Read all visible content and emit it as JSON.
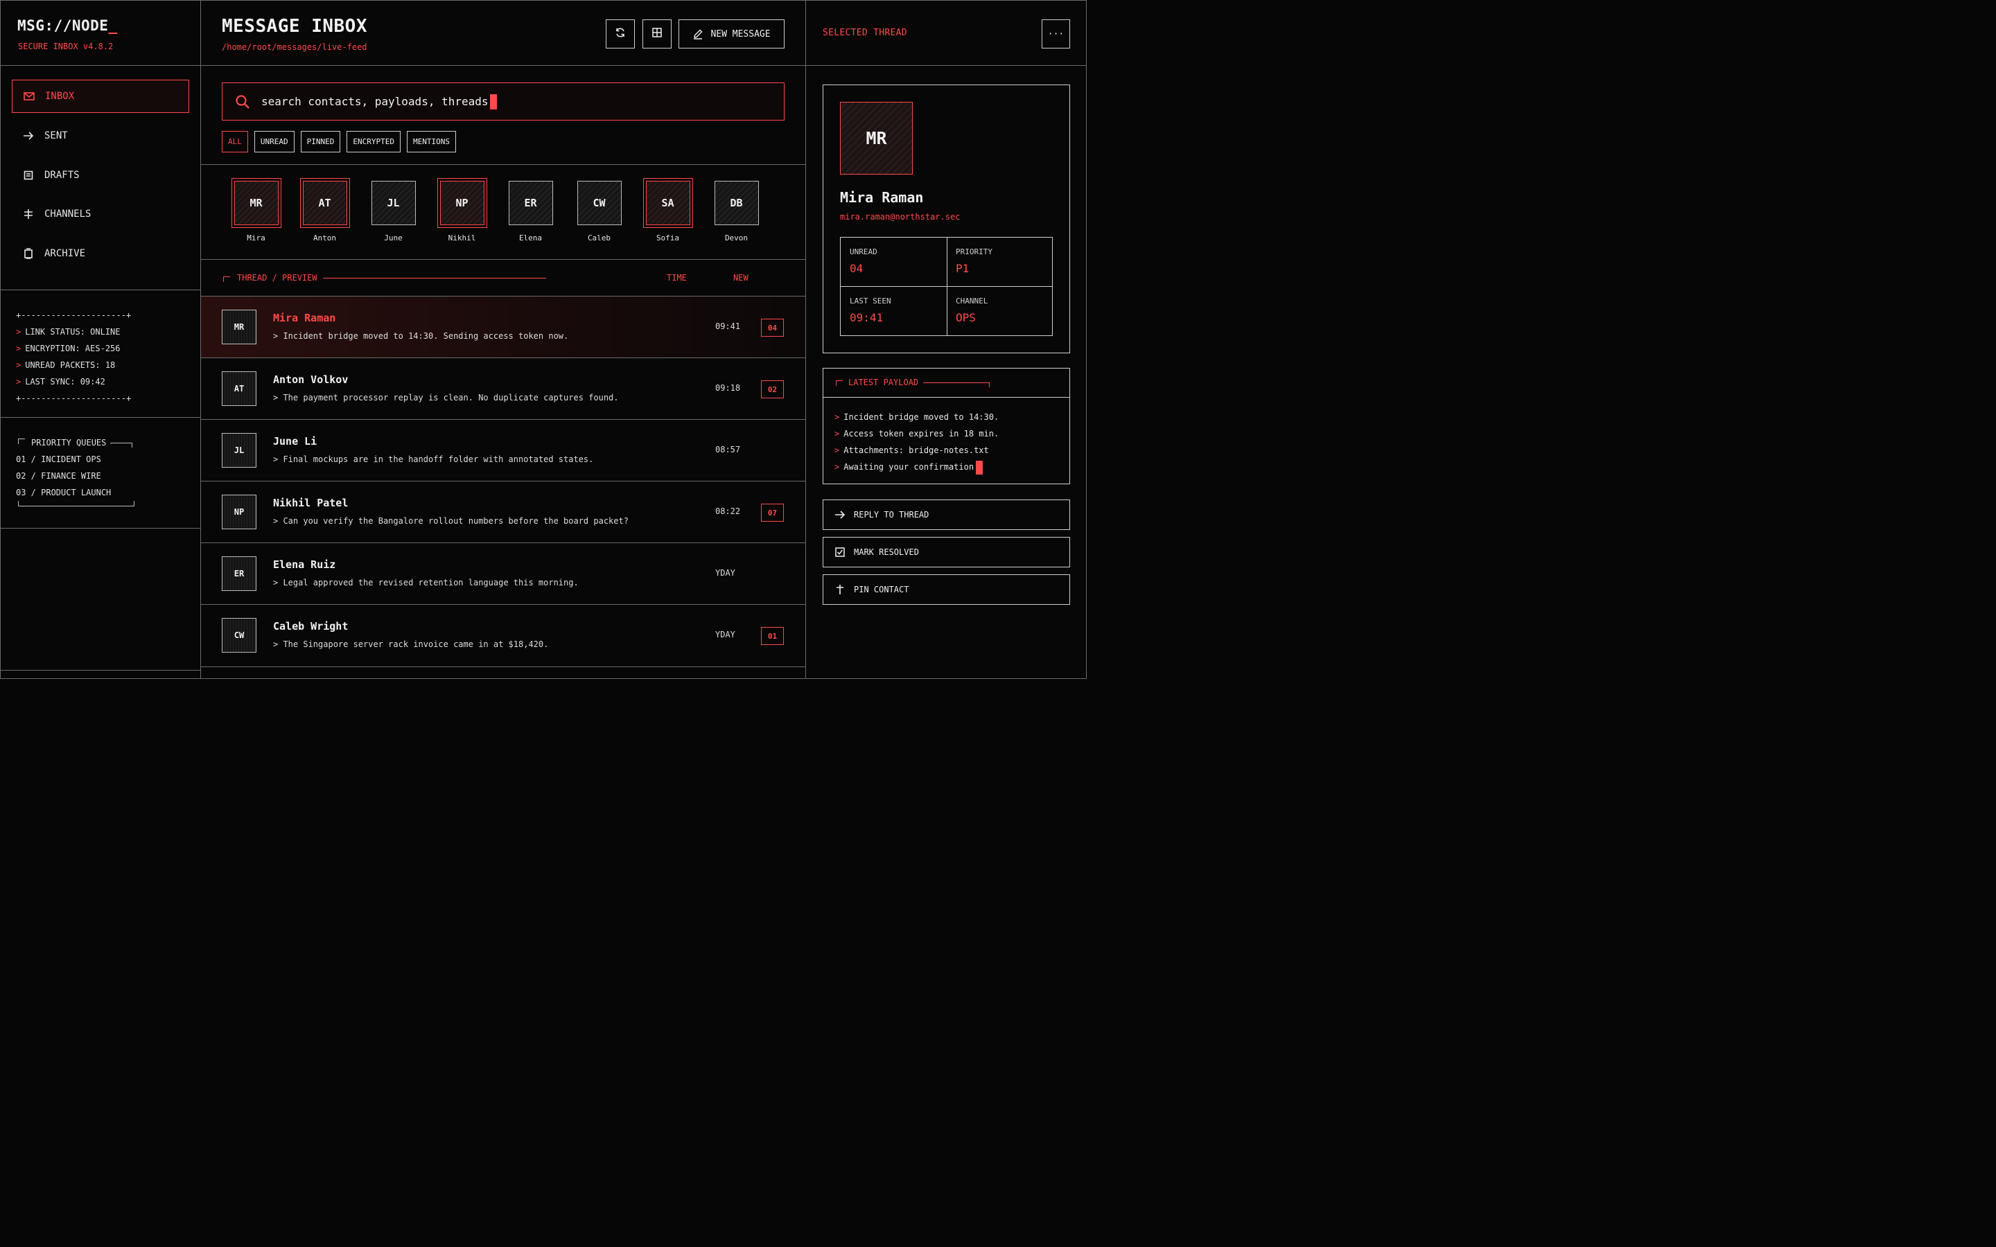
{
  "brand": {
    "name": "MSG://NODE",
    "cursor": "_",
    "version": "SECURE INBOX v4.8.2"
  },
  "nav": [
    {
      "label": "INBOX",
      "icon": "mail-icon",
      "active": true
    },
    {
      "label": "SENT",
      "icon": "arrow-right-icon"
    },
    {
      "label": "DRAFTS",
      "icon": "draft-icon"
    },
    {
      "label": "CHANNELS",
      "icon": "channel-icon"
    },
    {
      "label": "ARCHIVE",
      "icon": "archive-icon"
    }
  ],
  "status": {
    "border": "+---------------------+",
    "lines": [
      "LINK STATUS: ONLINE",
      "ENCRYPTION: AES-256",
      "UNREAD PACKETS: 18",
      "LAST SYNC: 09:42"
    ]
  },
  "queues": {
    "title": "PRIORITY QUEUES",
    "items": [
      "01 / INCIDENT OPS",
      "02 / FINANCE WIRE",
      "03 / PRODUCT LAUNCH"
    ]
  },
  "header": {
    "title": "MESSAGE INBOX",
    "path": "/home/root/messages/live-feed",
    "new_message": "NEW MESSAGE"
  },
  "search": {
    "text": "search contacts, payloads, threads"
  },
  "filters": [
    "ALL",
    "UNREAD",
    "PINNED",
    "ENCRYPTED",
    "MENTIONS"
  ],
  "contacts": [
    {
      "initials": "MR",
      "name": "Mira",
      "hl": true
    },
    {
      "initials": "AT",
      "name": "Anton",
      "hl": true
    },
    {
      "initials": "JL",
      "name": "June",
      "hl": false
    },
    {
      "initials": "NP",
      "name": "Nikhil",
      "hl": true
    },
    {
      "initials": "ER",
      "name": "Elena",
      "hl": false
    },
    {
      "initials": "CW",
      "name": "Caleb",
      "hl": false
    },
    {
      "initials": "SA",
      "name": "Sofia",
      "hl": true
    },
    {
      "initials": "DB",
      "name": "Devon",
      "hl": false
    }
  ],
  "list_head": {
    "label": "THREAD / PREVIEW",
    "time": "TIME",
    "new": "NEW"
  },
  "threads": [
    {
      "initials": "MR",
      "name": "Mira Raman",
      "preview": "> Incident bridge moved to 14:30. Sending access token now.",
      "time": "09:41",
      "badge": "04",
      "selected": true
    },
    {
      "initials": "AT",
      "name": "Anton Volkov",
      "preview": "> The payment processor replay is clean. No duplicate captures found.",
      "time": "09:18",
      "badge": "02"
    },
    {
      "initials": "JL",
      "name": "June Li",
      "preview": "> Final mockups are in the handoff folder with annotated states.",
      "time": "08:57",
      "badge": ""
    },
    {
      "initials": "NP",
      "name": "Nikhil Patel",
      "preview": "> Can you verify the Bangalore rollout numbers before the board packet?",
      "time": "08:22",
      "badge": "07"
    },
    {
      "initials": "ER",
      "name": "Elena Ruiz",
      "preview": "> Legal approved the revised retention language this morning.",
      "time": "YDAY",
      "badge": ""
    },
    {
      "initials": "CW",
      "name": "Caleb Wright",
      "preview": "> The Singapore server rack invoice came in at $18,420.",
      "time": "YDAY",
      "badge": "01"
    }
  ],
  "selected": {
    "title": "SELECTED THREAD",
    "more": "···",
    "initials": "MR",
    "name": "Mira Raman",
    "email": "mira.raman@northstar.sec",
    "stats": [
      {
        "label": "UNREAD",
        "value": "04"
      },
      {
        "label": "PRIORITY",
        "value": "P1"
      },
      {
        "label": "LAST SEEN",
        "value": "09:41"
      },
      {
        "label": "CHANNEL",
        "value": "OPS"
      }
    ],
    "payload_title": "LATEST PAYLOAD",
    "payload": [
      "Incident bridge moved to 14:30.",
      "Access token expires in 18 min.",
      "Attachments: bridge-notes.txt",
      "Awaiting your confirmation"
    ],
    "actions": [
      {
        "label": "REPLY TO THREAD",
        "icon": "reply-arrow-icon"
      },
      {
        "label": "MARK RESOLVED",
        "icon": "checkbox-icon"
      },
      {
        "label": "PIN CONTACT",
        "icon": "pin-icon"
      }
    ]
  },
  "colors": {
    "accent": "#ff4a4a",
    "background": "#070707",
    "border": "#6a6a6a"
  }
}
